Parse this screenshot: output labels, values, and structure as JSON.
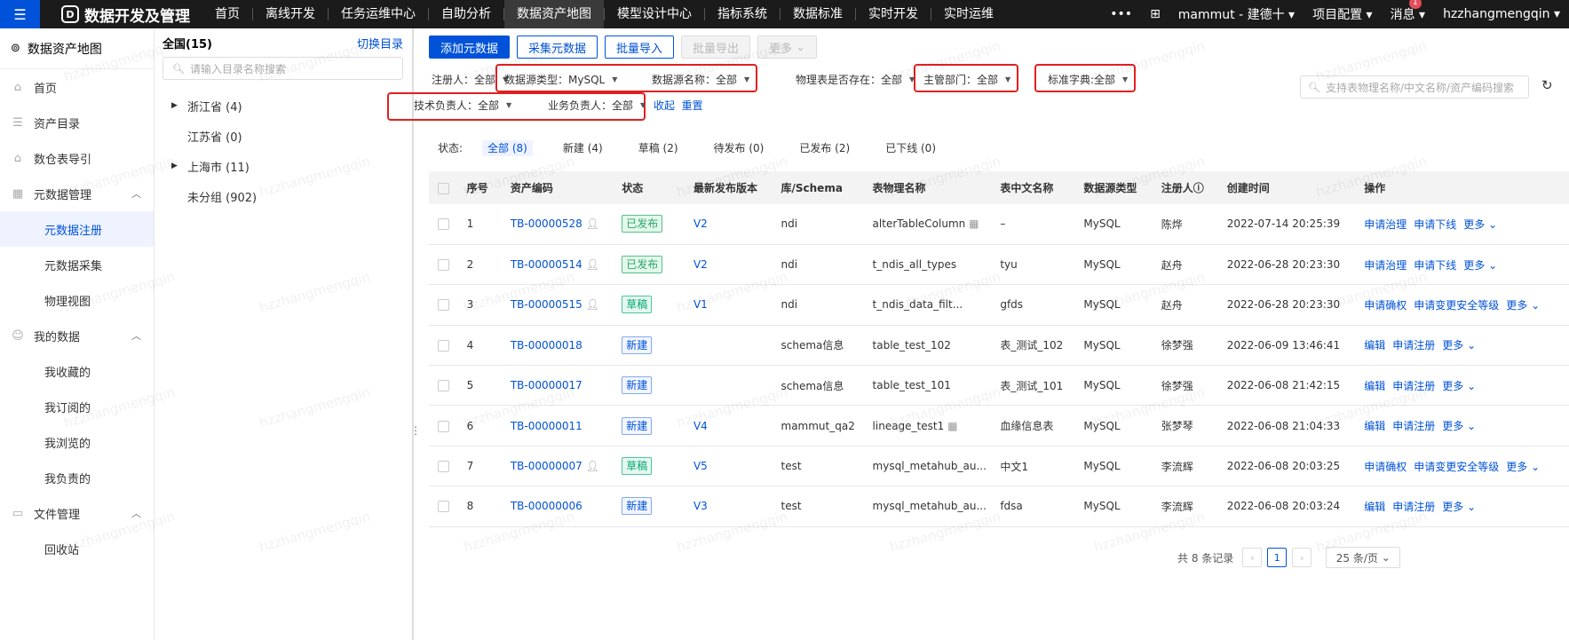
{
  "topbar": {
    "app_title": "数据开发及管理",
    "nav": [
      "首页",
      "离线开发",
      "任务运维中心",
      "自助分析",
      "数据资产地图",
      "模型设计中心",
      "指标系统",
      "数据标准",
      "实时开发",
      "实时运维"
    ],
    "active_nav": "数据资产地图",
    "more": "•••",
    "project": "mammut - 建德十",
    "project_config": "项目配置",
    "messages": "消息",
    "message_badge": "1",
    "user": "hzzhangmengqin"
  },
  "sidebar": {
    "title": "数据资产地图",
    "items": [
      {
        "label": "首页",
        "icon": "home-icon"
      },
      {
        "label": "资产目录",
        "icon": "catalog-icon"
      },
      {
        "label": "数仓表导引",
        "icon": "warehouse-icon"
      }
    ],
    "groups": [
      {
        "label": "元数据管理",
        "icon": "metadata-icon",
        "children": [
          "元数据注册",
          "元数据采集",
          "物理视图"
        ]
      },
      {
        "label": "我的数据",
        "icon": "user-icon",
        "children": [
          "我收藏的",
          "我订阅的",
          "我浏览的",
          "我负责的"
        ]
      },
      {
        "label": "文件管理",
        "icon": "folder-icon",
        "children": [
          "回收站"
        ]
      }
    ],
    "active_child": "元数据注册"
  },
  "tree": {
    "title": "全国(15)",
    "switch": "切换目录",
    "search_placeholder": "请输入目录名称搜索",
    "nodes": [
      {
        "label": "浙江省 (4)",
        "expandable": true
      },
      {
        "label": "江苏省 (0)",
        "expandable": false
      },
      {
        "label": "上海市 (11)",
        "expandable": true
      },
      {
        "label": "未分组 (902)",
        "expandable": false
      }
    ]
  },
  "toolbar": {
    "add": "添加元数据",
    "collect": "采集元数据",
    "import": "批量导入",
    "export": "批量导出",
    "more": "更多"
  },
  "filters": {
    "registrant": "注册人：全部",
    "source_type": "数据源类型：MySQL",
    "source_name": "数据源名称：全部",
    "physical_exists": "物理表是否存在：全部",
    "department": "主管部门：全部",
    "std_dict": "标准字典:全部",
    "tech_owner": "技术负责人：全部",
    "biz_owner": "业务负责人：全部",
    "collapse": "收起",
    "reset": "重置",
    "search_placeholder": "支持表物理名称/中文名称/资产编码搜索"
  },
  "status": {
    "label": "状态:",
    "tabs": [
      "全部 (8)",
      "新建 (4)",
      "草稿 (2)",
      "待发布 (0)",
      "已发布 (2)",
      "已下线 (0)"
    ],
    "active": "全部 (8)"
  },
  "table": {
    "headers": [
      "序号",
      "资产编码",
      "状态",
      "最新发布版本",
      "库/Schema",
      "表物理名称",
      "表中文名称",
      "数据源类型",
      "注册人",
      "创建时间",
      "操作"
    ],
    "rows": [
      {
        "no": "1",
        "code": "TB-00000528",
        "user_icon": true,
        "status": "已发布",
        "ver": "V2",
        "schema": "ndi",
        "pname": "alterTableColumn",
        "grid_icon": true,
        "cname": "–",
        "dtype": "MySQL",
        "reg": "陈烨",
        "time": "2022-07-14 20:25:39",
        "ops": [
          "申请治理",
          "申请下线",
          "更多"
        ]
      },
      {
        "no": "2",
        "code": "TB-00000514",
        "user_icon": true,
        "status": "已发布",
        "ver": "V2",
        "schema": "ndi",
        "pname": "t_ndis_all_types",
        "grid_icon": false,
        "cname": "tyu",
        "dtype": "MySQL",
        "reg": "赵舟",
        "time": "2022-06-28 20:23:30",
        "ops": [
          "申请治理",
          "申请下线",
          "更多"
        ]
      },
      {
        "no": "3",
        "code": "TB-00000515",
        "user_icon": true,
        "status": "草稿",
        "ver": "V1",
        "schema": "ndi",
        "pname": "t_ndis_data_filt...",
        "grid_icon": false,
        "cname": "gfds",
        "dtype": "MySQL",
        "reg": "赵舟",
        "time": "2022-06-28 20:23:30",
        "ops": [
          "申请确权",
          "申请变更安全等级",
          "更多"
        ]
      },
      {
        "no": "4",
        "code": "TB-00000018",
        "user_icon": false,
        "status": "新建",
        "ver": "",
        "schema": "schema信息",
        "pname": "table_test_102",
        "grid_icon": false,
        "cname": "表_测试_102",
        "dtype": "MySQL",
        "reg": "徐梦强",
        "time": "2022-06-09 13:46:41",
        "ops": [
          "编辑",
          "申请注册",
          "更多"
        ]
      },
      {
        "no": "5",
        "code": "TB-00000017",
        "user_icon": false,
        "status": "新建",
        "ver": "",
        "schema": "schema信息",
        "pname": "table_test_101",
        "grid_icon": false,
        "cname": "表_测试_101",
        "dtype": "MySQL",
        "reg": "徐梦强",
        "time": "2022-06-08 21:42:15",
        "ops": [
          "编辑",
          "申请注册",
          "更多"
        ]
      },
      {
        "no": "6",
        "code": "TB-00000011",
        "user_icon": false,
        "status": "新建",
        "ver": "V4",
        "schema": "mammut_qa2",
        "pname": "lineage_test1",
        "grid_icon": true,
        "cname": "血缘信息表",
        "dtype": "MySQL",
        "reg": "张梦琴",
        "time": "2022-06-08 21:04:33",
        "ops": [
          "编辑",
          "申请注册",
          "更多"
        ]
      },
      {
        "no": "7",
        "code": "TB-00000007",
        "user_icon": true,
        "status": "草稿",
        "ver": "V5",
        "schema": "test",
        "pname": "mysql_metahub_au...",
        "grid_icon": false,
        "cname": "中文1",
        "dtype": "MySQL",
        "reg": "李流辉",
        "time": "2022-06-08 20:03:25",
        "ops": [
          "申请确权",
          "申请变更安全等级",
          "更多"
        ]
      },
      {
        "no": "8",
        "code": "TB-00000006",
        "user_icon": false,
        "status": "新建",
        "ver": "V3",
        "schema": "test",
        "pname": "mysql_metahub_au...",
        "grid_icon": false,
        "cname": "fdsa",
        "dtype": "MySQL",
        "reg": "李流辉",
        "time": "2022-06-08 20:03:24",
        "ops": [
          "编辑",
          "申请注册",
          "更多"
        ]
      }
    ]
  },
  "pagination": {
    "total": "共 8 条记录",
    "page": "1",
    "page_size": "25 条/页"
  },
  "status_colors": {
    "已发布": {
      "fg": "#2ba471",
      "bg": "#e3f9e9",
      "border": "#56c08d"
    },
    "草稿": {
      "fg": "#00a870",
      "bg": "#e6f7f1",
      "border": "#48c79c"
    },
    "新建": {
      "fg": "#0052d9",
      "bg": "#f2f6ff",
      "border": "#85a9f1"
    }
  },
  "watermark": "hzzhangmengqin"
}
